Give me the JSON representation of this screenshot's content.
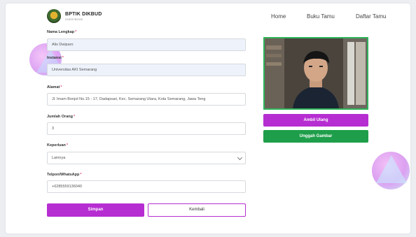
{
  "brand": {
    "title": "BPTIK DIKBUD",
    "subtitle": "GUESTBOOK"
  },
  "nav": {
    "home": "Home",
    "buku_tamu": "Buku Tamu",
    "daftar_tamu": "Daftar Tamu"
  },
  "form": {
    "nama": {
      "label": "Nama Lengkap",
      "value": "Alis Dwiparo"
    },
    "instansi": {
      "label": "Instansi",
      "value": "Universitas AKI Semarang"
    },
    "alamat": {
      "label": "Alamat",
      "value": "Jl. Imam Bonjol No.15 - 17, Dadapsari, Kec. Semarang Utara, Kota Semarang, Jawa Teng"
    },
    "jumlah": {
      "label": "Jumlah Orang",
      "value": "3"
    },
    "keperluan": {
      "label": "Keperluan",
      "value": "Lainnya"
    },
    "telpon": {
      "label": "Telpon/WhatsApp",
      "value": "+6285559136040"
    },
    "required_mark": "*"
  },
  "buttons": {
    "simpan": "Simpan",
    "kembali": "Kembali",
    "ambil_ulang": "Ambil Ulang",
    "unggah_gambar": "Unggah Gambar"
  },
  "colors": {
    "purple": "#b62ed1",
    "green": "#1e9e4a",
    "photo_border": "#2fb45a"
  },
  "icons": {
    "logo": "provincial-emblem-icon",
    "select": "chevron-down-icon"
  }
}
